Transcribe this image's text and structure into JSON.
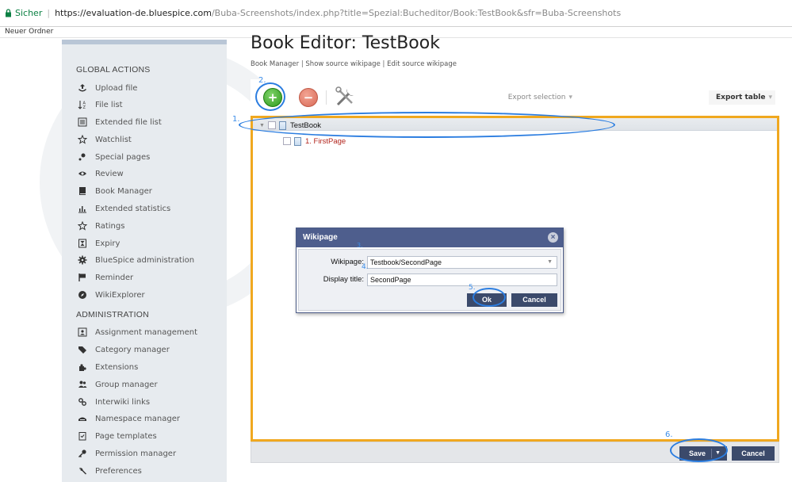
{
  "browser": {
    "secure_label": "Sicher",
    "url_host": "https://evaluation-de.bluespice.com",
    "url_path": "/Buba-Screenshots/index.php?title=Spezial:Bucheditor/Book:TestBook&sfr=Buba-Screenshots",
    "bookmark": "Neuer Ordner"
  },
  "sidebar": {
    "global_heading": "GLOBAL ACTIONS",
    "global_items": [
      {
        "label": "Upload file",
        "icon": "upload-icon"
      },
      {
        "label": "File list",
        "icon": "sort-icon"
      },
      {
        "label": "Extended file list",
        "icon": "list-box-icon"
      },
      {
        "label": "Watchlist",
        "icon": "star-icon"
      },
      {
        "label": "Special pages",
        "icon": "special-icon"
      },
      {
        "label": "Review",
        "icon": "eye-icon"
      },
      {
        "label": "Book Manager",
        "icon": "book-icon"
      },
      {
        "label": "Extended statistics",
        "icon": "chart-icon"
      },
      {
        "label": "Ratings",
        "icon": "star-icon"
      },
      {
        "label": "Expiry",
        "icon": "hourglass-icon"
      },
      {
        "label": "BlueSpice administration",
        "icon": "gear-icon"
      },
      {
        "label": "Reminder",
        "icon": "flag-icon"
      },
      {
        "label": "WikiExplorer",
        "icon": "compass-icon"
      }
    ],
    "admin_heading": "ADMINISTRATION",
    "admin_items": [
      {
        "label": "Assignment management",
        "icon": "assign-icon"
      },
      {
        "label": "Category manager",
        "icon": "tag-icon"
      },
      {
        "label": "Extensions",
        "icon": "puzzle-icon"
      },
      {
        "label": "Group manager",
        "icon": "group-icon"
      },
      {
        "label": "Interwiki links",
        "icon": "link-icon"
      },
      {
        "label": "Namespace manager",
        "icon": "namespace-icon"
      },
      {
        "label": "Page templates",
        "icon": "template-icon"
      },
      {
        "label": "Permission manager",
        "icon": "key-icon"
      },
      {
        "label": "Preferences",
        "icon": "wrench-icon"
      }
    ]
  },
  "main": {
    "title": "Book Editor: TestBook",
    "links": [
      "Book Manager",
      "Show source wikipage",
      "Edit source wikipage"
    ],
    "toolbar": {
      "export_selection": "Export selection",
      "export_table": "Export table"
    },
    "tree": {
      "root": "TestBook",
      "children": [
        "1. FirstPage"
      ]
    },
    "buttons": {
      "save": "Save",
      "cancel": "Cancel"
    }
  },
  "dialog": {
    "title": "Wikipage",
    "wikipage_label": "Wikipage:",
    "wikipage_value": "Testbook/SecondPage",
    "display_title_label": "Display title:",
    "display_title_value": "SecondPage",
    "ok": "Ok",
    "cancel": "Cancel"
  },
  "annotations": {
    "n1": "1.",
    "n2": "2.",
    "n3": "3.",
    "n4": "4.",
    "n5": "5.",
    "n6": "6."
  },
  "colors": {
    "highlight_frame": "#f0a81f",
    "annotation_blue": "#2b7de0",
    "button_dark": "#3b4a6b",
    "dialog_header": "#4e5e8d"
  }
}
